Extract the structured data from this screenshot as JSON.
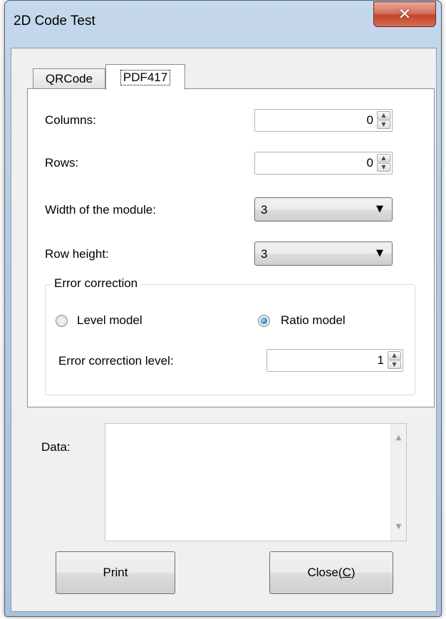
{
  "window": {
    "title": "2D Code Test"
  },
  "tabs": [
    {
      "label": "QRCode",
      "selected": false
    },
    {
      "label": "PDF417",
      "selected": true
    }
  ],
  "pdf417": {
    "columns": {
      "label": "Columns:",
      "value": "0"
    },
    "rows": {
      "label": "Rows:",
      "value": "0"
    },
    "module_width": {
      "label": "Width of the module:",
      "value": "3"
    },
    "row_height": {
      "label": "Row height:",
      "value": "3"
    },
    "error_correction": {
      "title": "Error correction",
      "level_model": {
        "label": "Level model",
        "checked": false
      },
      "ratio_model": {
        "label": "Ratio model",
        "checked": true
      },
      "level": {
        "label": "Error correction level:",
        "value": "1"
      }
    }
  },
  "data_field": {
    "label": "Data:",
    "value": ""
  },
  "buttons": {
    "print": "Print",
    "close_prefix": "Close(",
    "close_mnemonic": "C",
    "close_suffix": ")"
  },
  "icons": {
    "close": "close-x-icon",
    "spin_up": "arrow-up-icon",
    "spin_down": "arrow-down-icon",
    "dropdown": "chevron-down-icon"
  }
}
